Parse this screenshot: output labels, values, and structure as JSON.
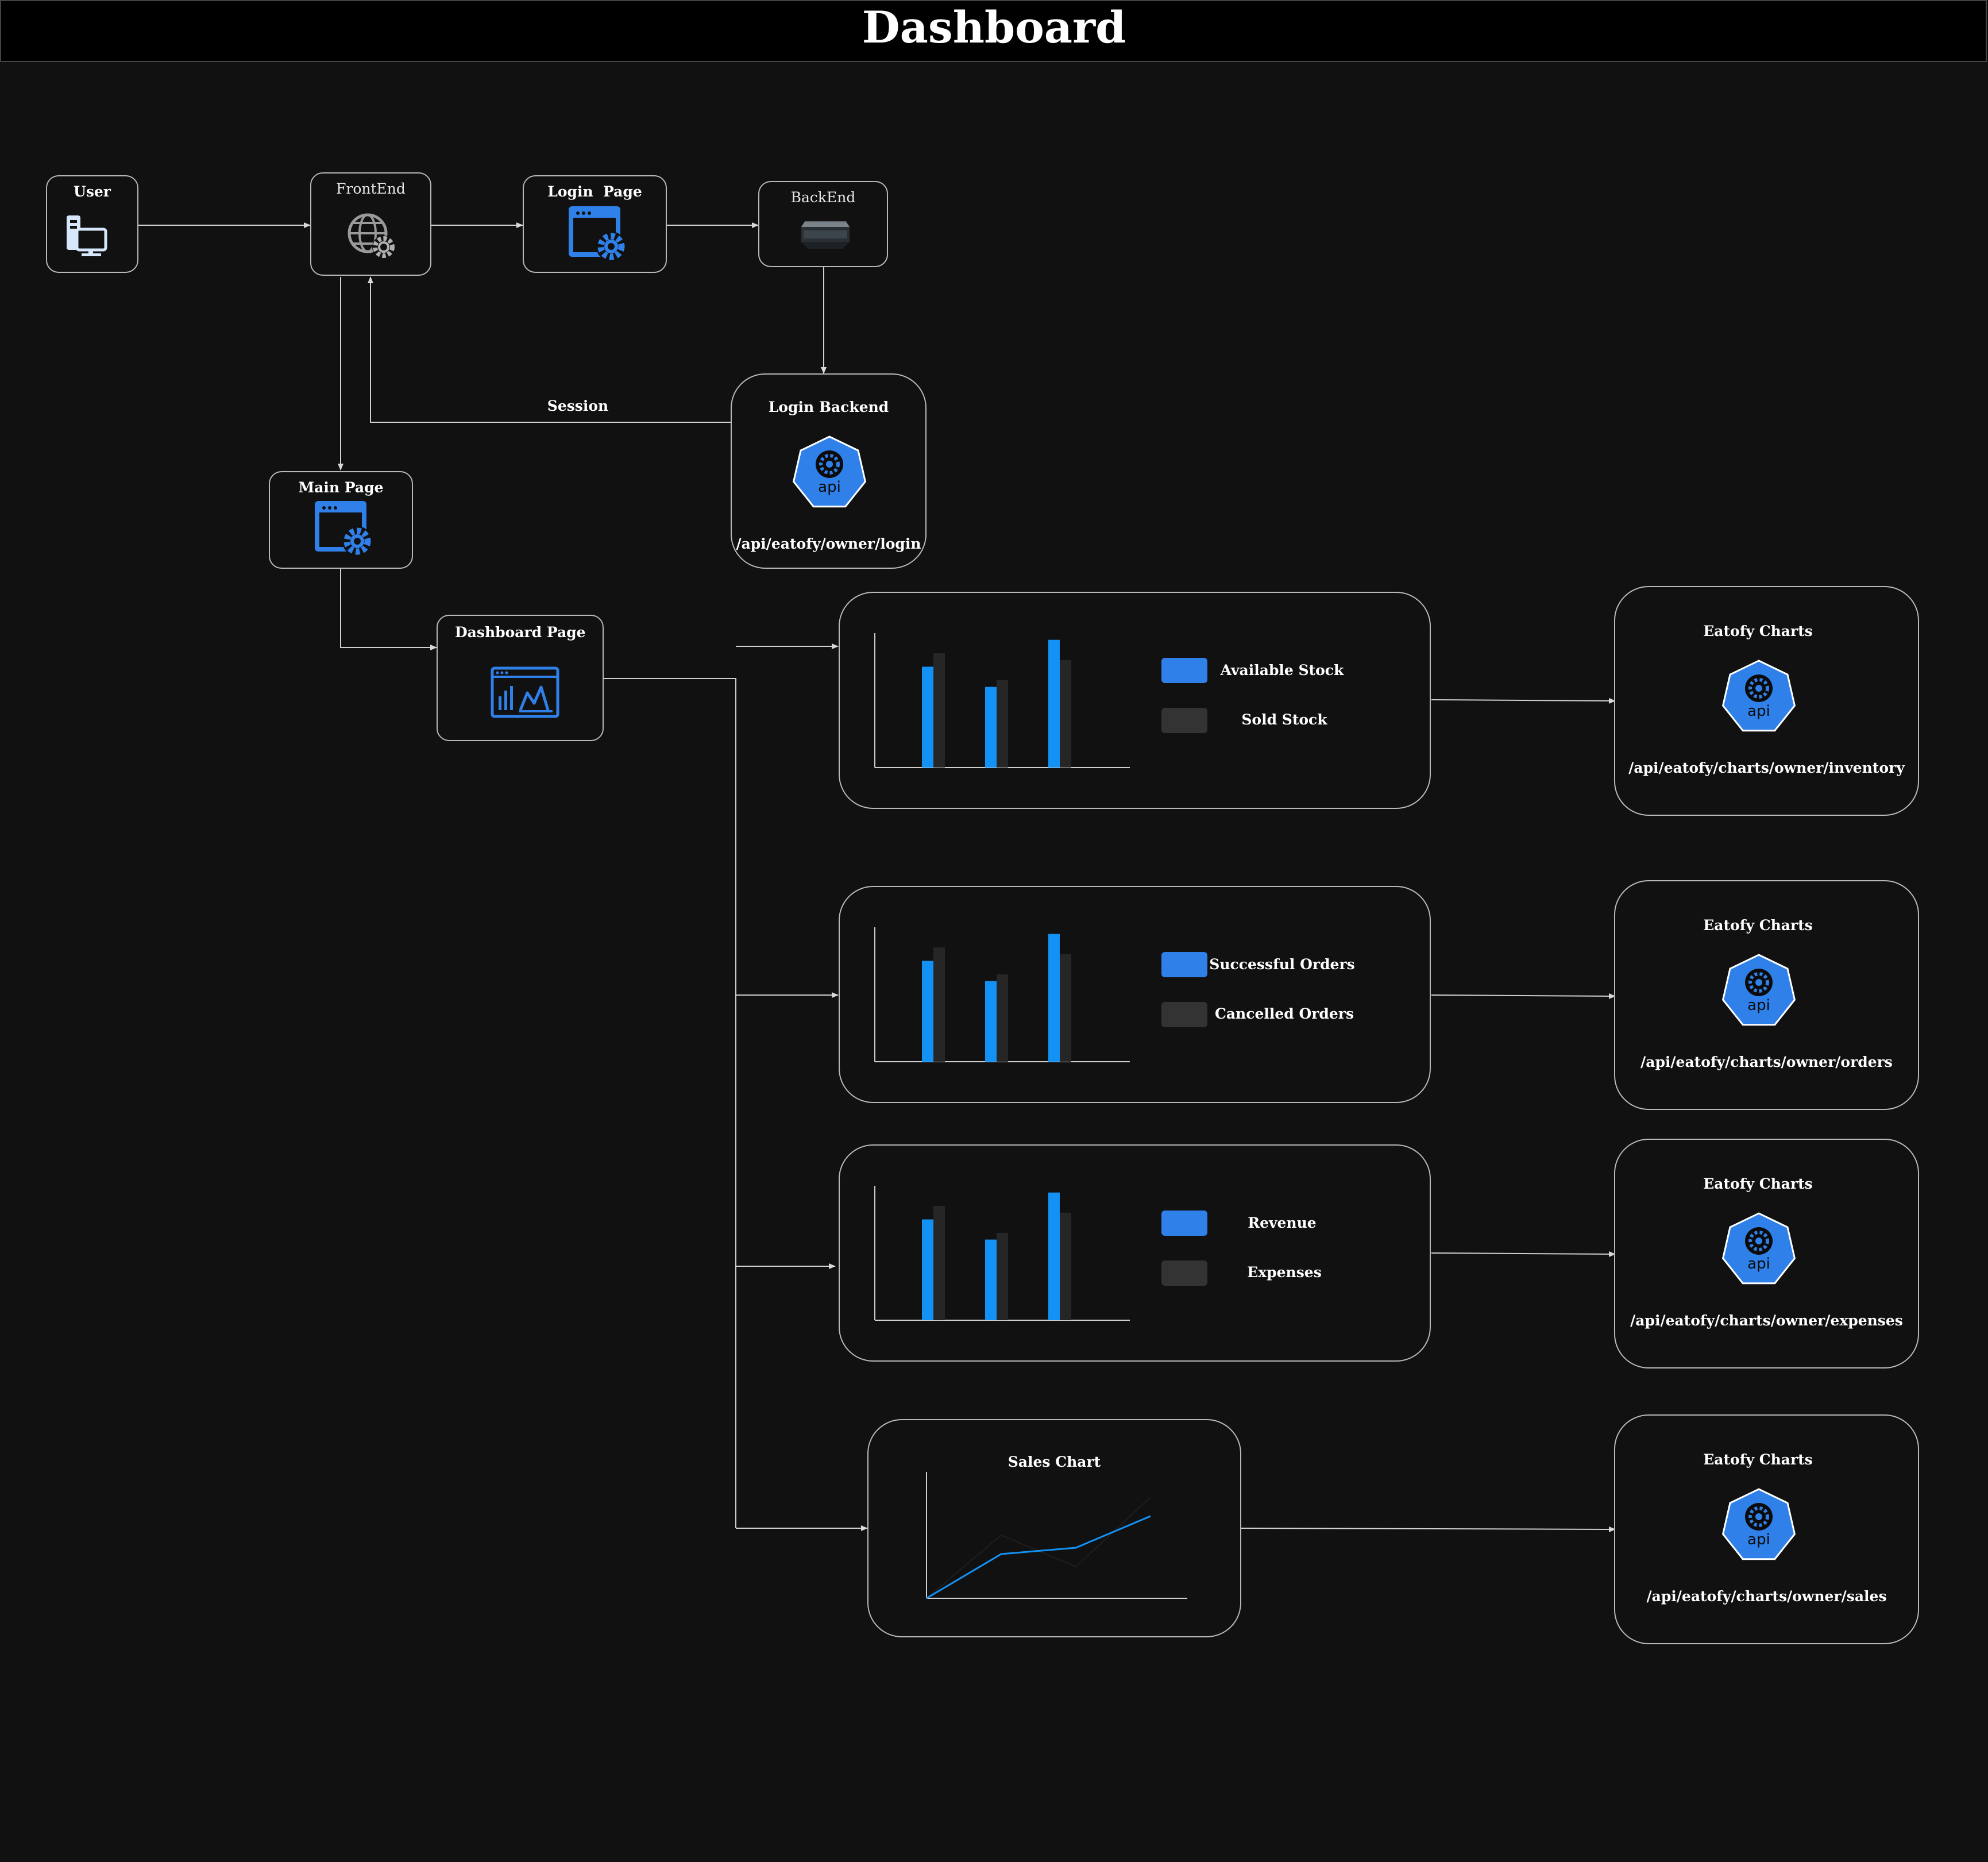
{
  "title": "Dashboard",
  "colors": {
    "background": "#111111",
    "title_bar": "#000000",
    "node_border": "#b8b8b8",
    "edge": "#cfcfcf",
    "accent_blue": "#2f80e8",
    "bar_blue": "#1392f5",
    "bar_dark": "#262626"
  },
  "nodes": {
    "user": {
      "label": "User",
      "icon": "computer-user-icon"
    },
    "frontend": {
      "label": "FrontEnd",
      "icon": "globe-gear-icon"
    },
    "login_page": {
      "label": "Login  Page",
      "icon": "window-gear-icon"
    },
    "backend": {
      "label": "BackEnd",
      "icon": "server-icon"
    },
    "login_backend": {
      "label": "Login Backend",
      "icon": "api-icon",
      "endpoint": "/api/eatofy/owner/login"
    },
    "main_page": {
      "label": "Main Page",
      "icon": "window-gear-icon"
    },
    "dashboard_page": {
      "label": "Dashboard Page",
      "icon": "dashboard-chart-icon"
    }
  },
  "edge_labels": {
    "session": "Session"
  },
  "api_icon_text": "api",
  "charts": [
    {
      "legend": [
        "Available Stock",
        "Sold Stock"
      ],
      "api": {
        "label": "Eatofy Charts",
        "endpoint": "/api/eatofy/charts/owner/inventory"
      }
    },
    {
      "legend": [
        "Successful Orders",
        "Cancelled Orders"
      ],
      "api": {
        "label": "Eatofy Charts",
        "endpoint": "/api/eatofy/charts/owner/orders"
      }
    },
    {
      "legend": [
        "Revenue",
        "Expenses"
      ],
      "api": {
        "label": "Eatofy Charts",
        "endpoint": "/api/eatofy/charts/owner/expenses"
      }
    }
  ],
  "sales": {
    "title": "Sales Chart",
    "api": {
      "label": "Eatofy Charts",
      "endpoint": "/api/eatofy/charts/owner/sales"
    }
  },
  "chart_data": [
    {
      "type": "bar",
      "categories": [
        "",
        "",
        ""
      ],
      "series": [
        {
          "name": "Available Stock",
          "values": [
            0.75,
            0.6,
            0.95
          ]
        },
        {
          "name": "Sold Stock",
          "values": [
            0.85,
            0.65,
            0.8
          ]
        }
      ]
    },
    {
      "type": "bar",
      "categories": [
        "",
        "",
        ""
      ],
      "series": [
        {
          "name": "Successful Orders",
          "values": [
            0.75,
            0.6,
            0.95
          ]
        },
        {
          "name": "Cancelled Orders",
          "values": [
            0.85,
            0.65,
            0.8
          ]
        }
      ]
    },
    {
      "type": "bar",
      "categories": [
        "",
        "",
        ""
      ],
      "series": [
        {
          "name": "Revenue",
          "values": [
            0.75,
            0.6,
            0.95
          ]
        },
        {
          "name": "Expenses",
          "values": [
            0.85,
            0.65,
            0.8
          ]
        }
      ]
    },
    {
      "type": "line",
      "title": "Sales Chart",
      "x": [
        0,
        1,
        2,
        3
      ],
      "series": [
        {
          "values": [
            0,
            0.35,
            0.4,
            0.65
          ]
        },
        {
          "values": [
            0,
            0.5,
            0.25,
            0.8
          ]
        }
      ]
    }
  ]
}
